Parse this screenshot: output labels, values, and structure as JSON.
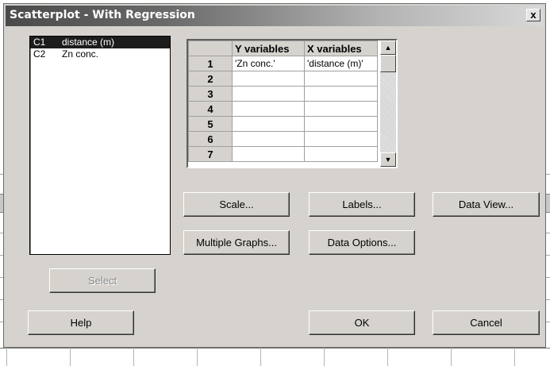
{
  "window": {
    "title": "Scatterplot - With Regression",
    "close_glyph": "x"
  },
  "variables": [
    {
      "col": "C1",
      "name": "distance (m)",
      "selected": true
    },
    {
      "col": "C2",
      "name": "Zn conc.",
      "selected": false
    }
  ],
  "grid": {
    "headers": [
      "Y variables",
      "X variables"
    ],
    "rows": [
      {
        "num": "1",
        "y": "'Zn conc.'",
        "x": "'distance (m)'"
      },
      {
        "num": "2",
        "y": "",
        "x": ""
      },
      {
        "num": "3",
        "y": "",
        "x": ""
      },
      {
        "num": "4",
        "y": "",
        "x": ""
      },
      {
        "num": "5",
        "y": "",
        "x": ""
      },
      {
        "num": "6",
        "y": "",
        "x": ""
      },
      {
        "num": "7",
        "y": "",
        "x": ""
      }
    ],
    "scroll_up_glyph": "▲",
    "scroll_down_glyph": "▼"
  },
  "buttons": {
    "scale": "Scale...",
    "labels": "Labels...",
    "data_view": "Data View...",
    "multiple_graphs": "Multiple Graphs...",
    "data_options": "Data Options...",
    "select": "Select",
    "help": "Help",
    "ok": "OK",
    "cancel": "Cancel"
  }
}
